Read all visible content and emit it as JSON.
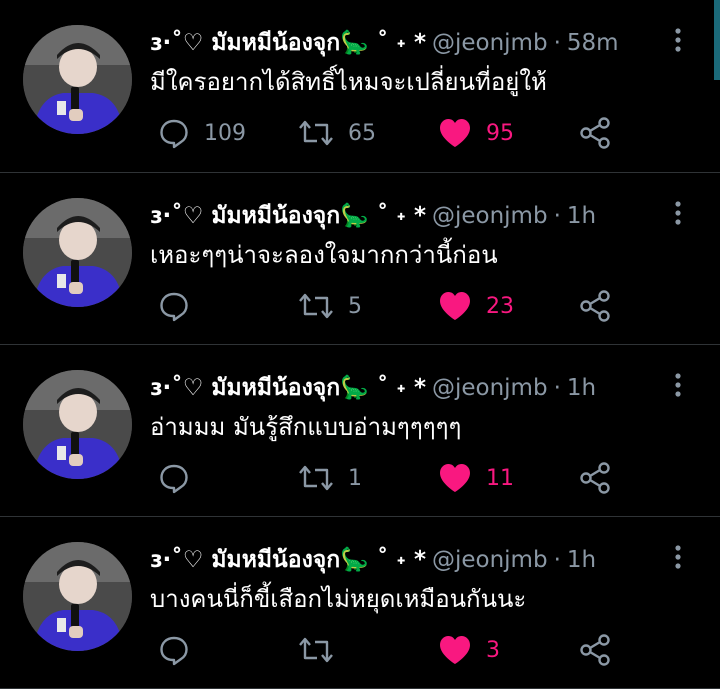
{
  "tweets": [
    {
      "name": "ɜ·˚♡ มัมหมีน้องจุก🦕 ˚ ˖ *",
      "handle": "@jeonjmb",
      "separator": "·",
      "time": "58m",
      "text": "มีใครอยากได้สิทธิ์ไหมจะเปลี่ยนที่อยู่ให้",
      "replies": "109",
      "retweets": "65",
      "likes": "95"
    },
    {
      "name": "ɜ·˚♡ มัมหมีน้องจุก🦕 ˚ ˖ *",
      "handle": "@jeonjmb",
      "separator": "·",
      "time": "1h",
      "text": "เหอะๆๆน่าจะลองใจมากกว่านี้ก่อน",
      "replies": "",
      "retweets": "5",
      "likes": "23"
    },
    {
      "name": "ɜ·˚♡ มัมหมีน้องจุก🦕 ˚ ˖ *",
      "handle": "@jeonjmb",
      "separator": "·",
      "time": "1h",
      "text": "อ่ามมม มันรู้สึกแบบอ่ามๆๆๆๆๆ",
      "replies": "",
      "retweets": "1",
      "likes": "11"
    },
    {
      "name": "ɜ·˚♡ มัมหมีน้องจุก🦕 ˚ ˖ *",
      "handle": "@jeonjmb",
      "separator": "·",
      "time": "1h",
      "text": "บางคนนี่ก็ขี้เสือกไม่หยุดเหมือนกันนะ",
      "replies": "",
      "retweets": "",
      "likes": "3"
    }
  ],
  "icons": {
    "reply": "reply-icon",
    "retweet": "retweet-icon",
    "like": "heart-icon",
    "share": "share-icon",
    "more": "more-vertical-icon"
  },
  "colors": {
    "background": "#000000",
    "text": "#ffffff",
    "muted": "#8b98a5",
    "like": "#f91880",
    "divider": "#2f3336"
  }
}
